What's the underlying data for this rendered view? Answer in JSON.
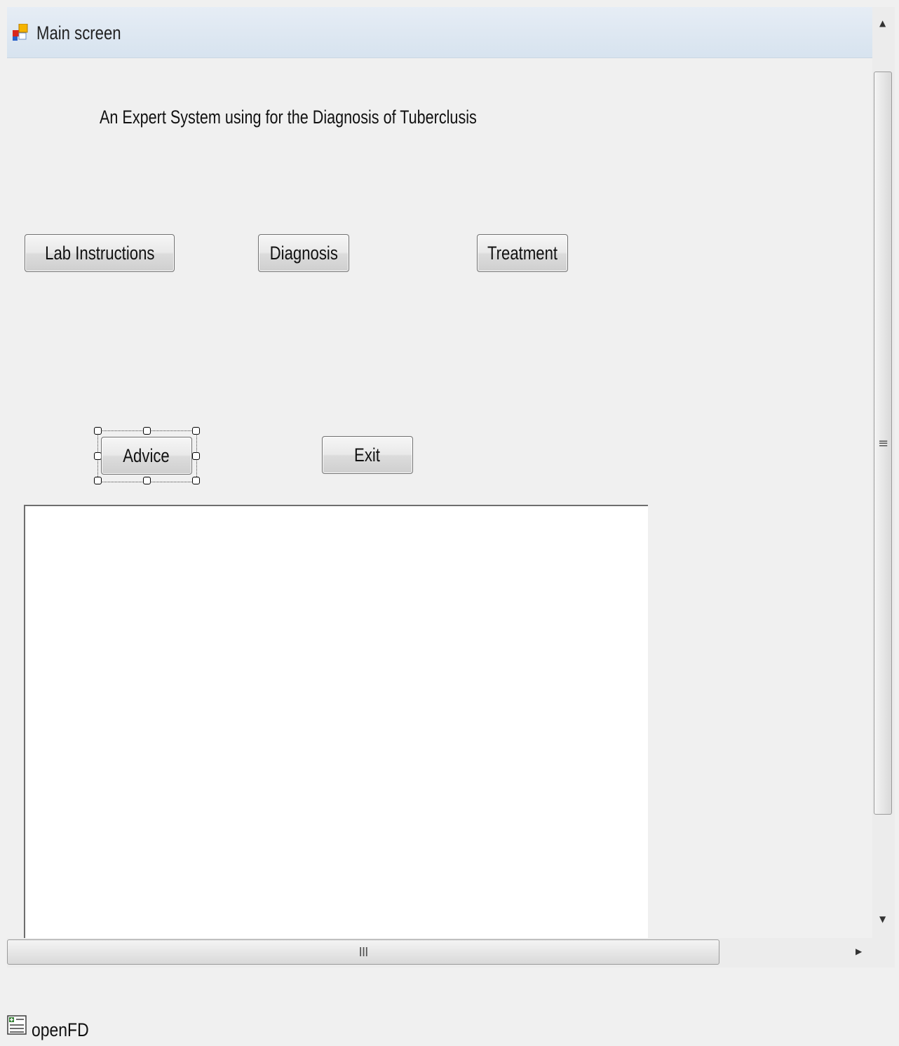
{
  "window": {
    "title": "Main screen",
    "heading": "An Expert System using for the Diagnosis of Tuberclusis"
  },
  "buttons": {
    "lab_instructions": "Lab Instructions",
    "diagnosis": "Diagnosis",
    "treatment": "Treatment",
    "advice": "Advice",
    "exit": "Exit"
  },
  "scrollbars": {
    "vertical_grip": "≡",
    "horizontal_grip": "III"
  },
  "component_tray": {
    "items": [
      {
        "label": "openFD",
        "icon": "file-dialog-icon"
      }
    ]
  },
  "icons": {
    "app": "form-icon",
    "component": "file-dialog-icon"
  },
  "colors": {
    "title_bar": "#dce7f2",
    "form_background": "#f0f0f0",
    "text_panel": "#ffffff"
  }
}
